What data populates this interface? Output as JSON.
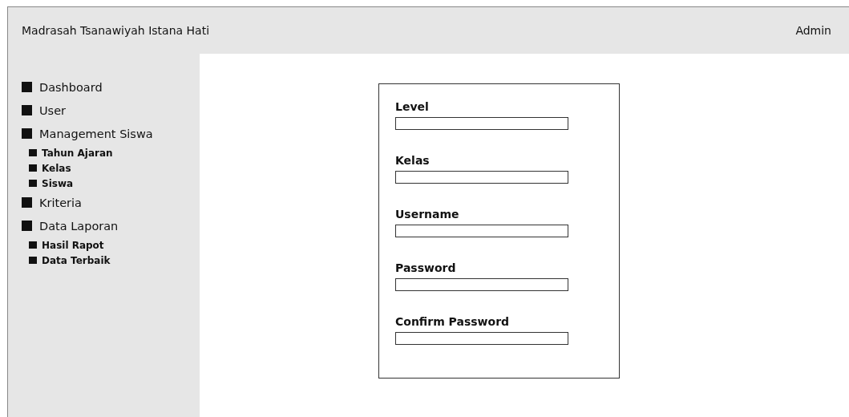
{
  "header": {
    "title": "Madrasah Tsanawiyah Istana Hati",
    "user": "Admin"
  },
  "sidebar": {
    "items": [
      {
        "label": "Dashboard"
      },
      {
        "label": "User"
      },
      {
        "label": "Management Siswa",
        "children": [
          {
            "label": "Tahun Ajaran"
          },
          {
            "label": "Kelas"
          },
          {
            "label": "Siswa"
          }
        ]
      },
      {
        "label": "Kriteria"
      },
      {
        "label": "Data Laporan",
        "children": [
          {
            "label": "Hasil Rapot"
          },
          {
            "label": "Data Terbaik"
          }
        ]
      }
    ]
  },
  "form": {
    "fields": [
      {
        "label": "Level"
      },
      {
        "label": "Kelas"
      },
      {
        "label": "Username"
      },
      {
        "label": "Password"
      },
      {
        "label": "Confirm Password"
      }
    ]
  }
}
